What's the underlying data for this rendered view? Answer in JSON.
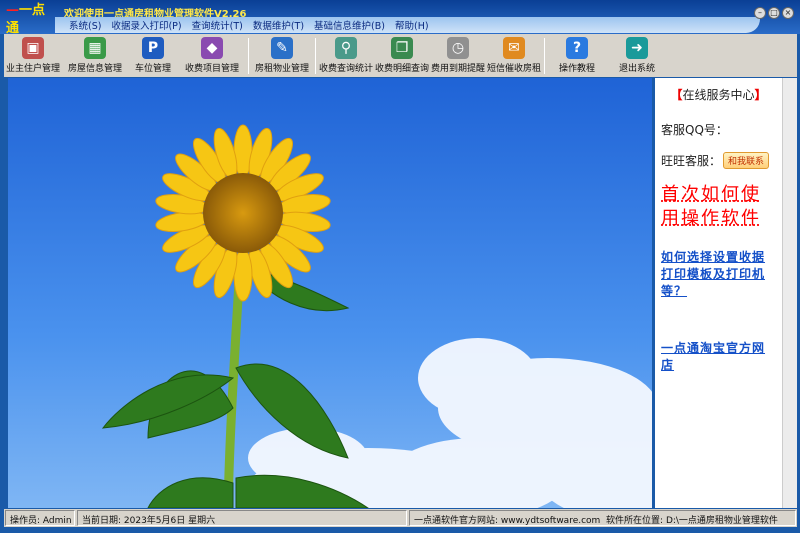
{
  "app": {
    "logo": "一点通",
    "title": "欢迎使用一点通房租物业管理软件V2.26"
  },
  "menu": [
    "系统(S)",
    "收据录入打印(P)",
    "查询统计(T)",
    "数据维护(T)",
    "基础信息维护(B)",
    "帮助(H)"
  ],
  "toolbar": [
    {
      "label": "业主住户管理",
      "icon": "id-card-icon",
      "color": "#c0504d"
    },
    {
      "label": "房屋信息管理",
      "icon": "building-icon",
      "color": "#3a9a48"
    },
    {
      "label": "车位管理",
      "icon": "parking-icon",
      "color": "#1e5cc0"
    },
    {
      "label": "收费项目管理",
      "icon": "cubes-icon",
      "color": "#8a4ab0"
    },
    {
      "label": "房租物业管理",
      "icon": "user-edit-icon",
      "color": "#2a70c8"
    },
    {
      "label": "收费查询统计",
      "icon": "magnifier-icon",
      "color": "#4a9a8a"
    },
    {
      "label": "收费明细查询",
      "icon": "book-user-icon",
      "color": "#3a8a50"
    },
    {
      "label": "费用到期提醒",
      "icon": "stopwatch-icon",
      "color": "#909090"
    },
    {
      "label": "短信催收房租",
      "icon": "sms-icon",
      "color": "#e08a20"
    },
    {
      "label": "操作教程",
      "icon": "help-icon",
      "color": "#2a7ae0"
    },
    {
      "label": "退出系统",
      "icon": "exit-door-icon",
      "color": "#1a9a9a"
    }
  ],
  "side": {
    "header": "在线服务中心",
    "qq_label": "客服QQ号：",
    "wangwang_label": "旺旺客服：",
    "chat_button": "和我联系",
    "tutorial_link": "首次如何使用操作软件",
    "print_link": "如何选择设置收据打印模板及打印机等？",
    "shop_link": "一点通淘宝官方网店"
  },
  "status": {
    "operator": "操作员: Admin",
    "date": "当前日期: 2023年5月6日 星期六",
    "website": "一点通软件官方网站: www.ydtsoftware.com",
    "location": "软件所在位置: D:\\一点通房租物业管理软件"
  }
}
